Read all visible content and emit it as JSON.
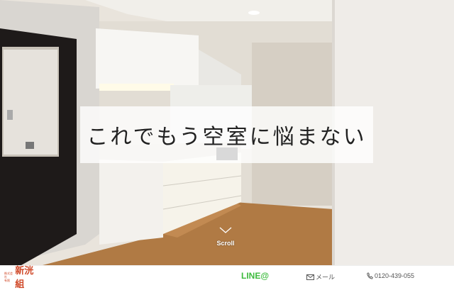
{
  "hero": {
    "headline": "これでもう空室に悩まない",
    "scroll_label": "Scroll"
  },
  "footer": {
    "logo_main": "新洸組",
    "logo_small_top": "株式会社",
    "logo_small_bottom": "有限",
    "line_label": "LINE@",
    "mail_label": "メール",
    "tel_label": "0120-439-055",
    "colors": {
      "line": "#3dbb3d",
      "logo": "#d04a2a"
    }
  }
}
